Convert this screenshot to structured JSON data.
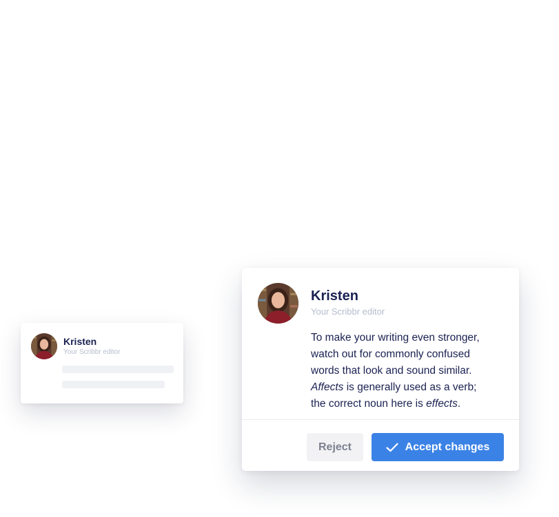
{
  "small_card": {
    "editor_name": "Kristen",
    "editor_role": "Your Scribbr editor"
  },
  "big_card": {
    "editor_name": "Kristen",
    "editor_role": "Your Scribbr editor",
    "message": {
      "line1": "To make your writing even stronger,",
      "line2": "watch out for commonly confused",
      "line3": "words that look and sound similar.",
      "line4_em": "Affects",
      "line4_rest": " is generally used as a verb;",
      "line5_pre": "the correct noun here is ",
      "line5_em": "effects",
      "line5_post": "."
    },
    "reject_label": "Reject",
    "accept_label": "Accept changes"
  },
  "colors": {
    "accent": "#3b82e6",
    "navy_text": "#1a2151",
    "muted_text": "#b5bccc",
    "reject_bg": "#f2f2f4"
  },
  "icons": {
    "accept": "check-icon"
  }
}
